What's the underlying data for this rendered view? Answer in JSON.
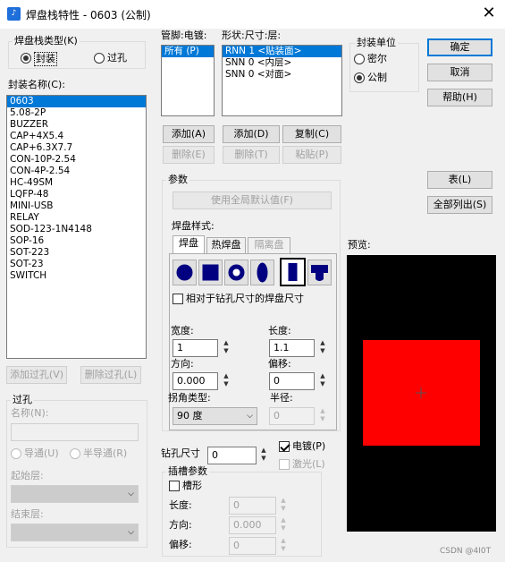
{
  "window": {
    "icon_glyph": "♪",
    "title": "焊盘栈特性 - 0603 (公制)"
  },
  "pad_stack_type": {
    "legend": "焊盘栈类型(K)",
    "options": [
      "封装",
      "过孔"
    ],
    "selected": 0
  },
  "package_name": {
    "label": "封装名称(C):",
    "items": [
      "0603",
      "5.08-2P",
      "BUZZER",
      "CAP+4X5.4",
      "CAP+6.3X7.7",
      "CON-10P-2.54",
      "CON-4P-2.54",
      "HC-49SM",
      "LQFP-48",
      "MINI-USB",
      "RELAY",
      "SOD-123-1N4148",
      "SOP-16",
      "SOT-223",
      "SOT-23",
      "SWITCH"
    ],
    "selected": 0
  },
  "via_buttons": {
    "add": "添加过孔(V)",
    "delete": "删除过孔(L)"
  },
  "via_group": {
    "legend": "过孔",
    "name_label": "名称(N):",
    "plated": "导通(U)",
    "nonplated": "半导通(R)",
    "start_layer": "起始层:",
    "end_layer": "结束层:"
  },
  "pin_plating": {
    "label": "管脚:电镀:",
    "items": [
      "所有 (P)"
    ],
    "selected": 0
  },
  "shape_size_layer": {
    "label": "形状:尺寸:层:",
    "items": [
      "RNN 1 <贴装面>",
      "SNN 0 <内层>",
      "SNN 0 <对面>"
    ],
    "selected": 0
  },
  "pin_buttons": {
    "add": "添加(A)",
    "delete": "删除(E)"
  },
  "layer_buttons": {
    "add": "添加(D)",
    "copy": "复制(C)",
    "delete": "删除(T)",
    "paste": "粘贴(P)"
  },
  "params": {
    "legend": "参数",
    "use_global": "使用全局默认值(F)",
    "pad_style_label": "焊盘样式:",
    "tabs": [
      "焊盘",
      "热焊盘",
      "隔离盘"
    ],
    "active_tab": 0,
    "shapes": [
      "round-pad-icon",
      "square-pad-icon",
      "annular-pad-icon",
      "oval-pad-icon",
      "rectangle-pad-icon",
      "odd-shape-pad-icon"
    ],
    "selected_shape": 4,
    "relative_drill": "相对于钻孔尺寸的焊盘尺寸",
    "width_label": "宽度:",
    "width": "1",
    "length_label": "长度:",
    "length": "1.1",
    "orientation_label": "方向:",
    "orientation": "0.000",
    "offset_label": "偏移:",
    "offset": "0",
    "corner_label": "拐角类型:",
    "corner": "90 度",
    "radius_label": "半径:",
    "radius": "0"
  },
  "drill": {
    "label": "钻孔尺寸",
    "value": "0",
    "plated_label": "电镀(P)",
    "plated": true,
    "laser_label": "激光(L)"
  },
  "slot": {
    "legend": "插槽参数",
    "slotted_label": "槽形",
    "length_label": "长度:",
    "length": "0",
    "orientation_label": "方向:",
    "orientation": "0.000",
    "offset_label": "偏移:",
    "offset": "0"
  },
  "units": {
    "legend": "封装单位",
    "options": [
      "密尔",
      "公制"
    ],
    "selected": 1
  },
  "buttons": {
    "ok": "确定",
    "cancel": "取消",
    "help": "帮助(H)",
    "table": "表(L)",
    "list_all": "全部列出(S)"
  },
  "preview": {
    "label": "预览:",
    "background": "#000000",
    "pad_color": "#ff0000"
  },
  "watermark": "CSDN @4I0T",
  "colors": {
    "selection": "#0078d7",
    "shape_fill": "#000080"
  }
}
